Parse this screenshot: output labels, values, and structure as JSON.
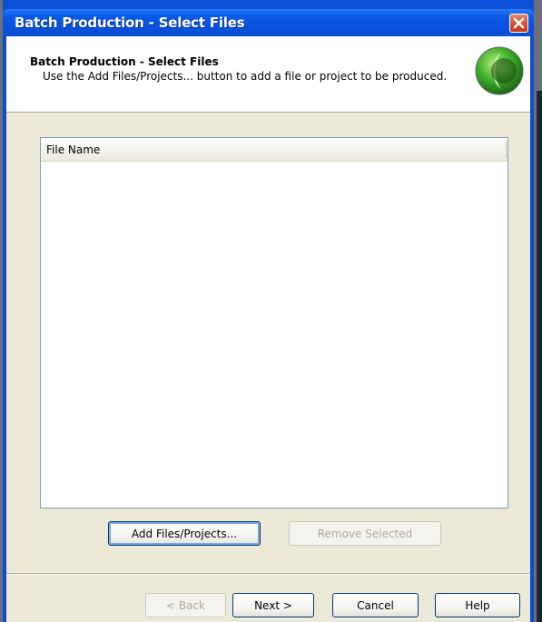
{
  "window": {
    "title": "Batch Production - Select Files"
  },
  "header": {
    "title": "Batch Production - Select Files",
    "description": "Use the Add Files/Projects... button to add a file or project to be produced."
  },
  "file_list": {
    "columns": [
      "File Name"
    ],
    "rows": []
  },
  "buttons": {
    "add_files": "Add Files/Projects...",
    "remove_selected": "Remove Selected",
    "back": "< Back",
    "next": "Next >",
    "cancel": "Cancel",
    "help": "Help"
  },
  "icons": {
    "close": "close-icon",
    "logo": "app-logo-icon"
  },
  "colors": {
    "titlebar": "#0a5be8",
    "close": "#d9482a",
    "dialog_bg": "#ece9d8",
    "logo_green": "#3aa82a"
  }
}
